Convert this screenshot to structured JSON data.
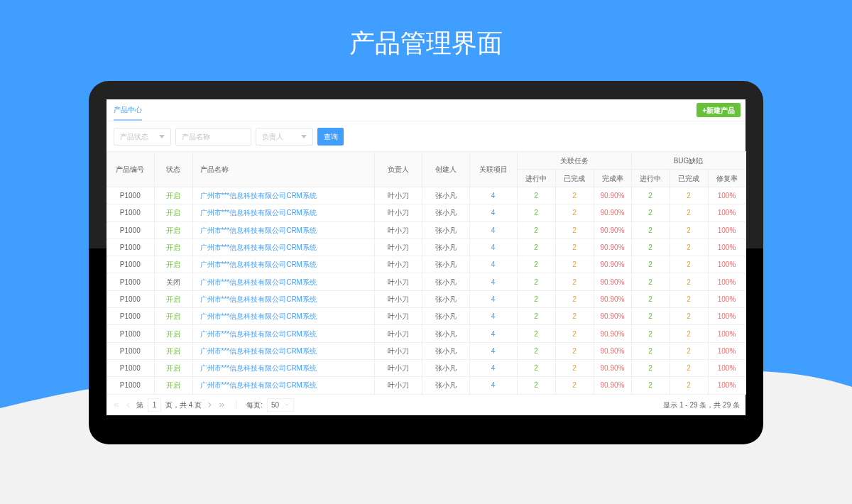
{
  "title": "产品管理界面",
  "tabs": [
    {
      "label": "产品中心",
      "selected": true
    }
  ],
  "new_button": "+新建产品",
  "filters": [
    {
      "kind": "select",
      "placeholder": "产品状态"
    },
    {
      "kind": "input",
      "placeholder": "产品名称"
    },
    {
      "kind": "select",
      "placeholder": "负责人"
    }
  ],
  "search_button": "查询",
  "table": {
    "columns": [
      "产品编号",
      "状态",
      "产品名称",
      "负责人",
      "创建人",
      "关联项目"
    ],
    "groups": [
      {
        "label": "关联任务",
        "columns": [
          "进行中",
          "已完成",
          "完成率"
        ]
      },
      {
        "label": "BUG缺陷",
        "columns": [
          "进行中",
          "已完成",
          "修复率"
        ]
      }
    ],
    "rows": [
      {
        "id": "P1000",
        "status": "开启",
        "on": true,
        "name": "广州市***信息科技有限公司CRM系统",
        "owner": "叶小刀",
        "creator": "张小凡",
        "projects": "4",
        "tasks": [
          "2",
          "2",
          "90.90%"
        ],
        "bugs": [
          "2",
          "2",
          "100%"
        ]
      },
      {
        "id": "P1000",
        "status": "开启",
        "on": true,
        "name": "广州市***信息科技有限公司CRM系统",
        "owner": "叶小刀",
        "creator": "张小凡",
        "projects": "4",
        "tasks": [
          "2",
          "2",
          "90.90%"
        ],
        "bugs": [
          "2",
          "2",
          "100%"
        ]
      },
      {
        "id": "P1000",
        "status": "开启",
        "on": true,
        "name": "广州市***信息科技有限公司CRM系统",
        "owner": "叶小刀",
        "creator": "张小凡",
        "projects": "4",
        "tasks": [
          "2",
          "2",
          "90.90%"
        ],
        "bugs": [
          "2",
          "2",
          "100%"
        ]
      },
      {
        "id": "P1000",
        "status": "开启",
        "on": true,
        "name": "广州市***信息科技有限公司CRM系统",
        "owner": "叶小刀",
        "creator": "张小凡",
        "projects": "4",
        "tasks": [
          "2",
          "2",
          "90.90%"
        ],
        "bugs": [
          "2",
          "2",
          "100%"
        ]
      },
      {
        "id": "P1000",
        "status": "开启",
        "on": true,
        "name": "广州市***信息科技有限公司CRM系统",
        "owner": "叶小刀",
        "creator": "张小凡",
        "projects": "4",
        "tasks": [
          "2",
          "2",
          "90.90%"
        ],
        "bugs": [
          "2",
          "2",
          "100%"
        ]
      },
      {
        "id": "P1000",
        "status": "关闭",
        "on": false,
        "name": "广州市***信息科技有限公司CRM系统",
        "owner": "叶小刀",
        "creator": "张小凡",
        "projects": "4",
        "tasks": [
          "2",
          "2",
          "90.90%"
        ],
        "bugs": [
          "2",
          "2",
          "100%"
        ]
      },
      {
        "id": "P1000",
        "status": "开启",
        "on": true,
        "name": "广州市***信息科技有限公司CRM系统",
        "owner": "叶小刀",
        "creator": "张小凡",
        "projects": "4",
        "tasks": [
          "2",
          "2",
          "90.90%"
        ],
        "bugs": [
          "2",
          "2",
          "100%"
        ]
      },
      {
        "id": "P1000",
        "status": "开启",
        "on": true,
        "name": "广州市***信息科技有限公司CRM系统",
        "owner": "叶小刀",
        "creator": "张小凡",
        "projects": "4",
        "tasks": [
          "2",
          "2",
          "90.90%"
        ],
        "bugs": [
          "2",
          "2",
          "100%"
        ]
      },
      {
        "id": "P1000",
        "status": "开启",
        "on": true,
        "name": "广州市***信息科技有限公司CRM系统",
        "owner": "叶小刀",
        "creator": "张小凡",
        "projects": "4",
        "tasks": [
          "2",
          "2",
          "90.90%"
        ],
        "bugs": [
          "2",
          "2",
          "100%"
        ]
      },
      {
        "id": "P1000",
        "status": "开启",
        "on": true,
        "name": "广州市***信息科技有限公司CRM系统",
        "owner": "叶小刀",
        "creator": "张小凡",
        "projects": "4",
        "tasks": [
          "2",
          "2",
          "90.90%"
        ],
        "bugs": [
          "2",
          "2",
          "100%"
        ]
      },
      {
        "id": "P1000",
        "status": "开启",
        "on": true,
        "name": "广州市***信息科技有限公司CRM系统",
        "owner": "叶小刀",
        "creator": "张小凡",
        "projects": "4",
        "tasks": [
          "2",
          "2",
          "90.90%"
        ],
        "bugs": [
          "2",
          "2",
          "100%"
        ]
      },
      {
        "id": "P1000",
        "status": "开启",
        "on": true,
        "name": "广州市***信息科技有限公司CRM系统",
        "owner": "叶小刀",
        "creator": "张小凡",
        "projects": "4",
        "tasks": [
          "2",
          "2",
          "90.90%"
        ],
        "bugs": [
          "2",
          "2",
          "100%"
        ]
      }
    ]
  },
  "pagination": {
    "page_prefix": "第",
    "page": "1",
    "page_suffix": "页，共 4 页",
    "per_page_label": "每页:",
    "per_page": "50",
    "summary": "显示 1 - 29 条，共 29 条"
  }
}
